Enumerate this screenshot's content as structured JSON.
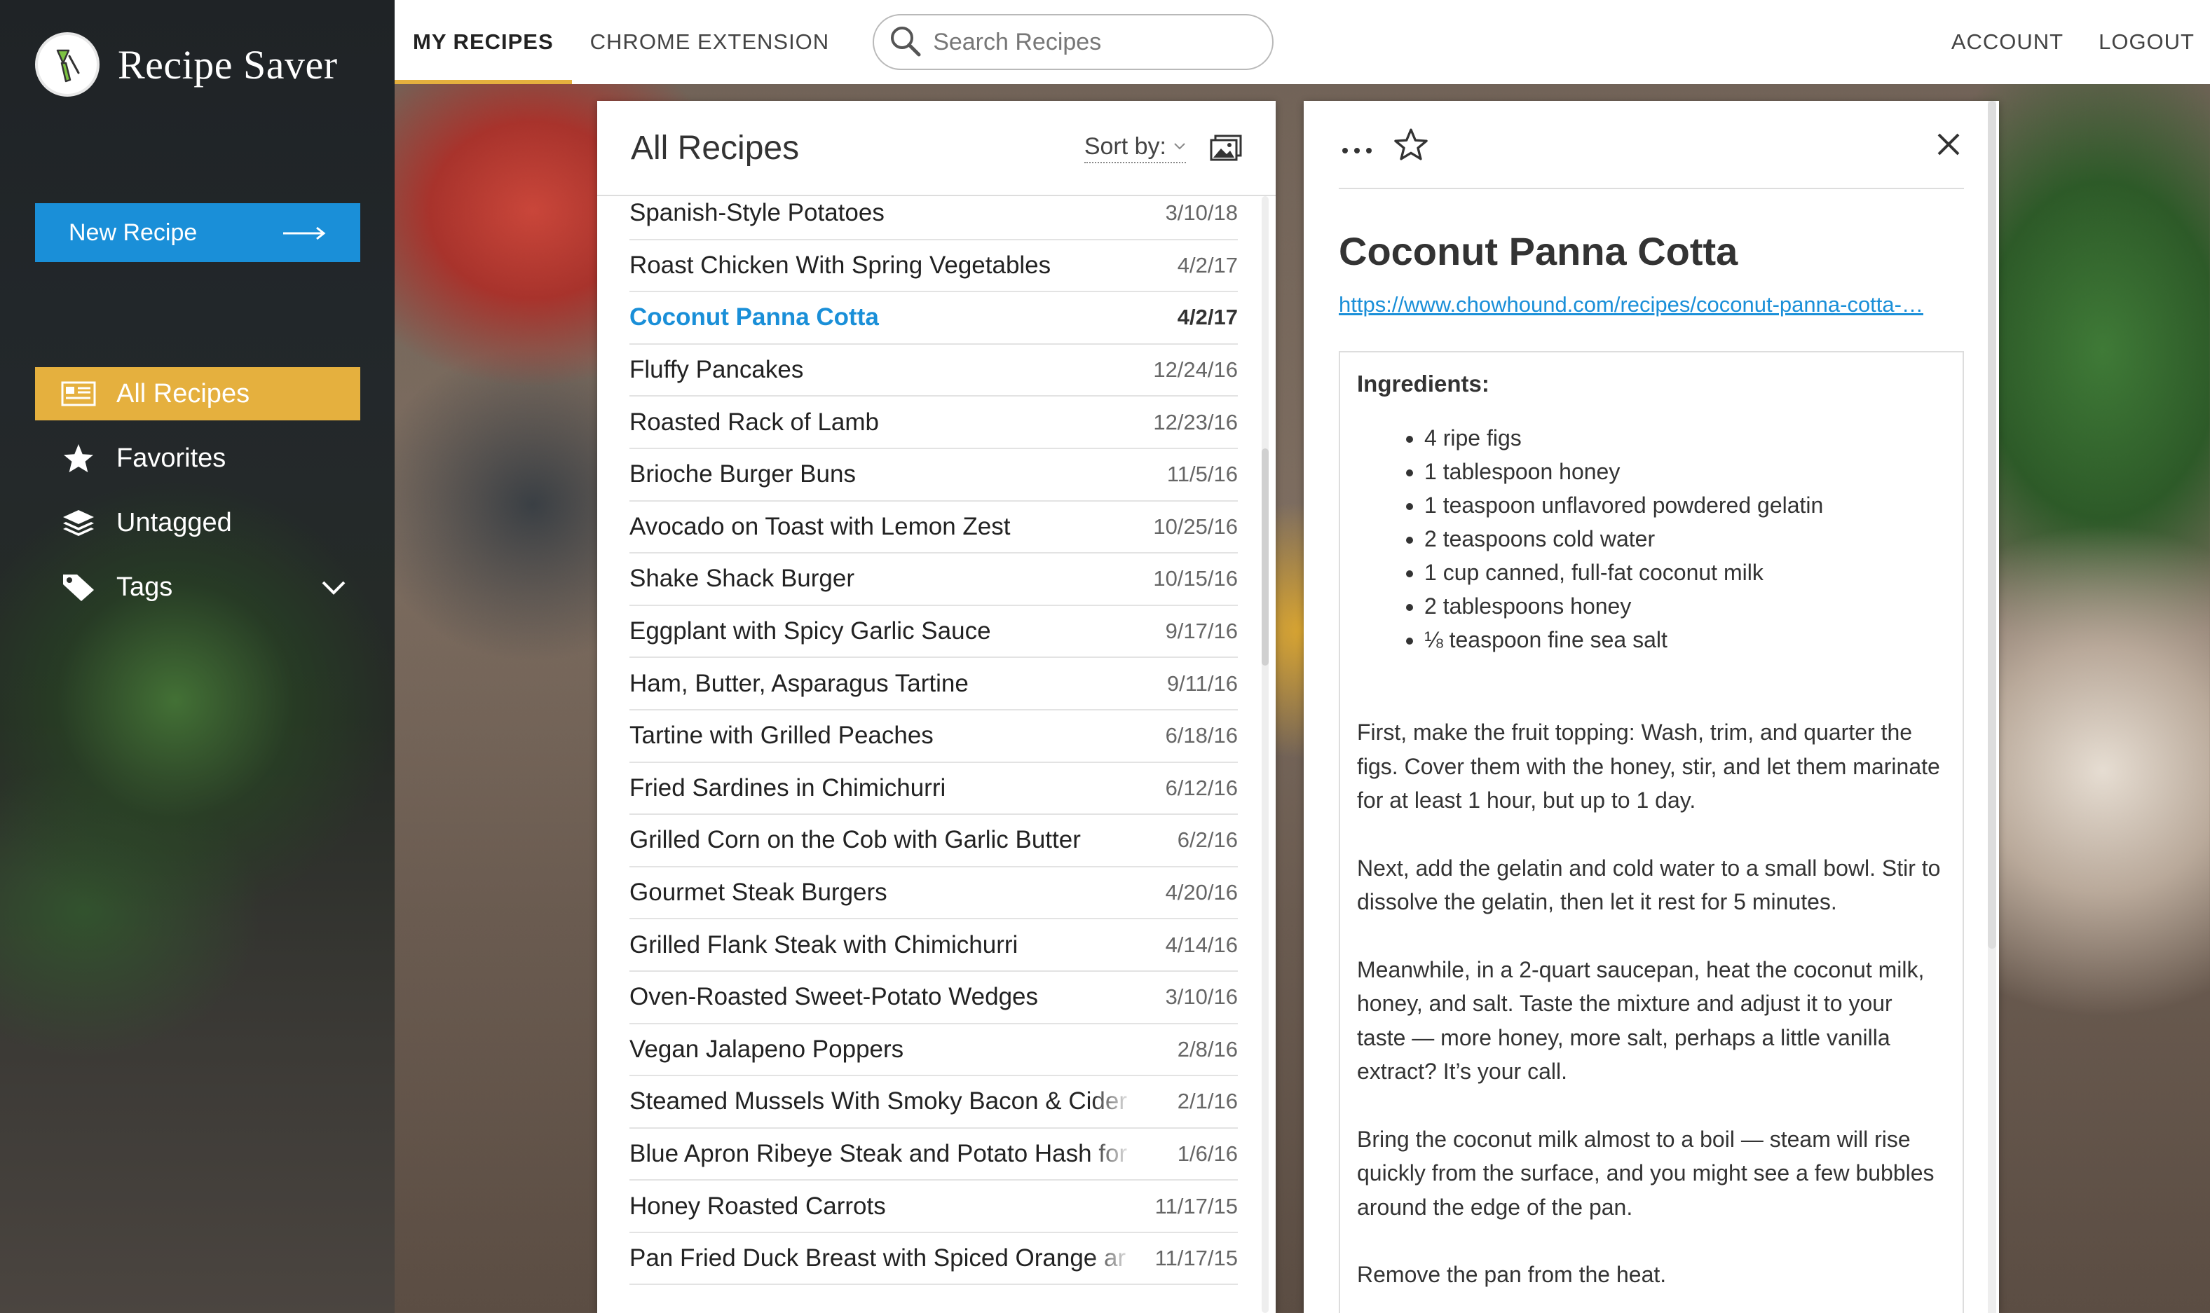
{
  "app": {
    "title": "Recipe Saver"
  },
  "sidebar": {
    "new_recipe_label": "New Recipe",
    "items": [
      {
        "label": "All Recipes",
        "icon": "recipes-list-icon",
        "active": true
      },
      {
        "label": "Favorites",
        "icon": "star-icon"
      },
      {
        "label": "Untagged",
        "icon": "layers-icon"
      },
      {
        "label": "Tags",
        "icon": "tag-icon"
      }
    ]
  },
  "topbar": {
    "tabs": [
      {
        "label": "MY RECIPES",
        "active": true
      },
      {
        "label": "CHROME EXTENSION"
      }
    ],
    "search_placeholder": "Search Recipes",
    "account_label": "ACCOUNT",
    "logout_label": "LOGOUT"
  },
  "list": {
    "title": "All Recipes",
    "sort_label": "Sort by:",
    "recipes": [
      {
        "name": "Spanish-Style Potatoes",
        "date": "3/10/18"
      },
      {
        "name": "Roast Chicken With Spring Vegetables",
        "date": "4/2/17"
      },
      {
        "name": "Coconut Panna Cotta",
        "date": "4/2/17",
        "selected": true
      },
      {
        "name": "Fluffy Pancakes",
        "date": "12/24/16"
      },
      {
        "name": "Roasted Rack of Lamb",
        "date": "12/23/16"
      },
      {
        "name": "Brioche Burger Buns",
        "date": "11/5/16"
      },
      {
        "name": "Avocado on Toast with Lemon Zest",
        "date": "10/25/16"
      },
      {
        "name": "Shake Shack Burger",
        "date": "10/15/16"
      },
      {
        "name": "Eggplant with Spicy Garlic Sauce",
        "date": "9/17/16"
      },
      {
        "name": "Ham, Butter, Asparagus Tartine",
        "date": "9/11/16"
      },
      {
        "name": "Tartine with Grilled Peaches",
        "date": "6/18/16"
      },
      {
        "name": "Fried Sardines in Chimichurri",
        "date": "6/12/16"
      },
      {
        "name": "Grilled Corn on the Cob with Garlic Butter",
        "date": "6/2/16"
      },
      {
        "name": "Gourmet Steak Burgers",
        "date": "4/20/16"
      },
      {
        "name": "Grilled Flank Steak with Chimichurri",
        "date": "4/14/16"
      },
      {
        "name": "Oven-Roasted Sweet-Potato Wedges",
        "date": "3/10/16"
      },
      {
        "name": "Vegan Jalapeno Poppers",
        "date": "2/8/16"
      },
      {
        "name": "Steamed Mussels With Smoky Bacon & Cider",
        "date": "2/1/16"
      },
      {
        "name": "Blue Apron Ribeye Steak and Potato Hash for",
        "date": "1/6/16"
      },
      {
        "name": "Honey Roasted Carrots",
        "date": "11/17/15"
      },
      {
        "name": "Pan Fried Duck Breast with Spiced Orange ar",
        "date": "11/17/15"
      }
    ]
  },
  "detail": {
    "title": "Coconut Panna Cotta",
    "url": "https://www.chowhound.com/recipes/coconut-panna-cotta-…",
    "ingredients_title": "Ingredients:",
    "ingredients": [
      "4 ripe figs",
      "1 tablespoon honey",
      "1 teaspoon unflavored powdered gelatin",
      "2 teaspoons cold water",
      "1 cup canned, full-fat coconut milk",
      "2 tablespoons honey",
      "⅛ teaspoon fine sea salt"
    ],
    "steps": [
      "First, make the fruit topping: Wash, trim, and quarter the figs. Cover them with the honey, stir, and let them marinate for at least 1 hour, but up to 1 day.",
      "Next, add the gelatin and cold water to a small bowl. Stir to dissolve the gelatin, then let it rest for 5 minutes.",
      "Meanwhile, in a 2-quart saucepan, heat the coconut milk, honey, and salt. Taste the mixture and adjust it to your taste — more honey, more salt, perhaps a little vanilla extract? It’s your call.",
      "Bring the coconut milk almost to a boil — steam will rise quickly from the surface, and you might see a few bubbles around the edge of the pan.",
      "Remove the pan from the heat."
    ]
  },
  "colors": {
    "accent_blue": "#1a8fd8",
    "accent_gold": "#e5b03e",
    "sidebar_bg": "#23282b"
  }
}
